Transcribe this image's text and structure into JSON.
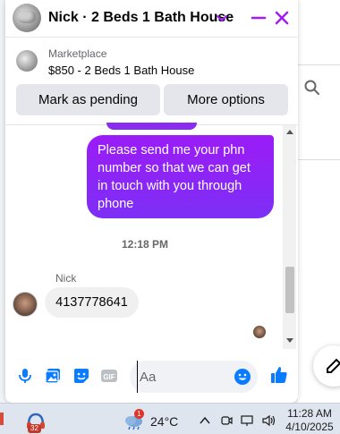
{
  "chat": {
    "title": "Nick · 2 Beds 1 Bath House",
    "marketplace_label": "Marketplace",
    "listing_title": "$850 - 2 Beds 1 Bath House",
    "actions": {
      "mark_pending": "Mark as pending",
      "more_options": "More options"
    }
  },
  "messages": {
    "outgoing_text": "Please send me your phn number so that we can get in touch with you through phone",
    "timestamp": "12:18 PM",
    "sender_name": "Nick",
    "incoming_text": "4137778641"
  },
  "composer": {
    "placeholder": "Aa"
  },
  "taskbar": {
    "app_badge": "32",
    "weather_badge": "1",
    "temperature": "24°C",
    "time": "11:28 AM",
    "date": "4/10/2025"
  },
  "colors": {
    "accent": "#a01ef5",
    "outgoing_bubble_top": "#9b1cf7",
    "outgoing_bubble_bottom": "#7d2ff5",
    "link_blue": "#0a7cff"
  },
  "icons": [
    "chevron-down-icon",
    "minimize-icon",
    "close-icon",
    "search-icon",
    "compose-icon",
    "microphone-icon",
    "gallery-icon",
    "sticker-icon",
    "gif-icon",
    "emoji-icon",
    "like-icon",
    "weather-icon"
  ]
}
